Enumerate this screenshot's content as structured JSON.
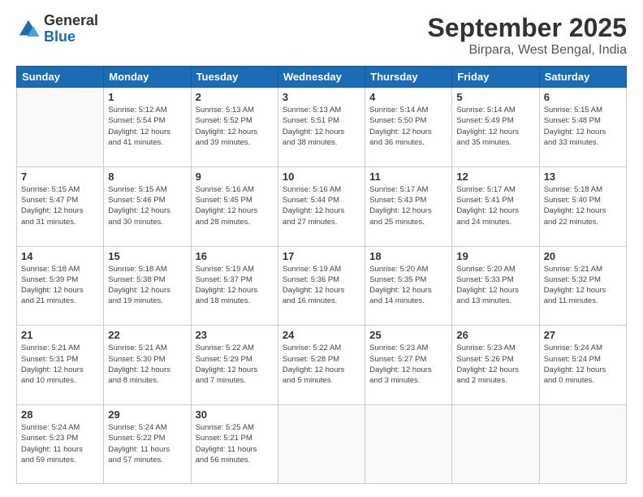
{
  "header": {
    "logo_line1": "General",
    "logo_line2": "Blue",
    "month": "September 2025",
    "location": "Birpara, West Bengal, India"
  },
  "weekdays": [
    "Sunday",
    "Monday",
    "Tuesday",
    "Wednesday",
    "Thursday",
    "Friday",
    "Saturday"
  ],
  "weeks": [
    [
      {
        "day": "",
        "info": ""
      },
      {
        "day": "1",
        "info": "Sunrise: 5:12 AM\nSunset: 5:54 PM\nDaylight: 12 hours\nand 41 minutes."
      },
      {
        "day": "2",
        "info": "Sunrise: 5:13 AM\nSunset: 5:52 PM\nDaylight: 12 hours\nand 39 minutes."
      },
      {
        "day": "3",
        "info": "Sunrise: 5:13 AM\nSunset: 5:51 PM\nDaylight: 12 hours\nand 38 minutes."
      },
      {
        "day": "4",
        "info": "Sunrise: 5:14 AM\nSunset: 5:50 PM\nDaylight: 12 hours\nand 36 minutes."
      },
      {
        "day": "5",
        "info": "Sunrise: 5:14 AM\nSunset: 5:49 PM\nDaylight: 12 hours\nand 35 minutes."
      },
      {
        "day": "6",
        "info": "Sunrise: 5:15 AM\nSunset: 5:48 PM\nDaylight: 12 hours\nand 33 minutes."
      }
    ],
    [
      {
        "day": "7",
        "info": "Sunrise: 5:15 AM\nSunset: 5:47 PM\nDaylight: 12 hours\nand 31 minutes."
      },
      {
        "day": "8",
        "info": "Sunrise: 5:15 AM\nSunset: 5:46 PM\nDaylight: 12 hours\nand 30 minutes."
      },
      {
        "day": "9",
        "info": "Sunrise: 5:16 AM\nSunset: 5:45 PM\nDaylight: 12 hours\nand 28 minutes."
      },
      {
        "day": "10",
        "info": "Sunrise: 5:16 AM\nSunset: 5:44 PM\nDaylight: 12 hours\nand 27 minutes."
      },
      {
        "day": "11",
        "info": "Sunrise: 5:17 AM\nSunset: 5:43 PM\nDaylight: 12 hours\nand 25 minutes."
      },
      {
        "day": "12",
        "info": "Sunrise: 5:17 AM\nSunset: 5:41 PM\nDaylight: 12 hours\nand 24 minutes."
      },
      {
        "day": "13",
        "info": "Sunrise: 5:18 AM\nSunset: 5:40 PM\nDaylight: 12 hours\nand 22 minutes."
      }
    ],
    [
      {
        "day": "14",
        "info": "Sunrise: 5:18 AM\nSunset: 5:39 PM\nDaylight: 12 hours\nand 21 minutes."
      },
      {
        "day": "15",
        "info": "Sunrise: 5:18 AM\nSunset: 5:38 PM\nDaylight: 12 hours\nand 19 minutes."
      },
      {
        "day": "16",
        "info": "Sunrise: 5:19 AM\nSunset: 5:37 PM\nDaylight: 12 hours\nand 18 minutes."
      },
      {
        "day": "17",
        "info": "Sunrise: 5:19 AM\nSunset: 5:36 PM\nDaylight: 12 hours\nand 16 minutes."
      },
      {
        "day": "18",
        "info": "Sunrise: 5:20 AM\nSunset: 5:35 PM\nDaylight: 12 hours\nand 14 minutes."
      },
      {
        "day": "19",
        "info": "Sunrise: 5:20 AM\nSunset: 5:33 PM\nDaylight: 12 hours\nand 13 minutes."
      },
      {
        "day": "20",
        "info": "Sunrise: 5:21 AM\nSunset: 5:32 PM\nDaylight: 12 hours\nand 11 minutes."
      }
    ],
    [
      {
        "day": "21",
        "info": "Sunrise: 5:21 AM\nSunset: 5:31 PM\nDaylight: 12 hours\nand 10 minutes."
      },
      {
        "day": "22",
        "info": "Sunrise: 5:21 AM\nSunset: 5:30 PM\nDaylight: 12 hours\nand 8 minutes."
      },
      {
        "day": "23",
        "info": "Sunrise: 5:22 AM\nSunset: 5:29 PM\nDaylight: 12 hours\nand 7 minutes."
      },
      {
        "day": "24",
        "info": "Sunrise: 5:22 AM\nSunset: 5:28 PM\nDaylight: 12 hours\nand 5 minutes."
      },
      {
        "day": "25",
        "info": "Sunrise: 5:23 AM\nSunset: 5:27 PM\nDaylight: 12 hours\nand 3 minutes."
      },
      {
        "day": "26",
        "info": "Sunrise: 5:23 AM\nSunset: 5:26 PM\nDaylight: 12 hours\nand 2 minutes."
      },
      {
        "day": "27",
        "info": "Sunrise: 5:24 AM\nSunset: 5:24 PM\nDaylight: 12 hours\nand 0 minutes."
      }
    ],
    [
      {
        "day": "28",
        "info": "Sunrise: 5:24 AM\nSunset: 5:23 PM\nDaylight: 11 hours\nand 59 minutes."
      },
      {
        "day": "29",
        "info": "Sunrise: 5:24 AM\nSunset: 5:22 PM\nDaylight: 11 hours\nand 57 minutes."
      },
      {
        "day": "30",
        "info": "Sunrise: 5:25 AM\nSunset: 5:21 PM\nDaylight: 11 hours\nand 56 minutes."
      },
      {
        "day": "",
        "info": ""
      },
      {
        "day": "",
        "info": ""
      },
      {
        "day": "",
        "info": ""
      },
      {
        "day": "",
        "info": ""
      }
    ]
  ]
}
